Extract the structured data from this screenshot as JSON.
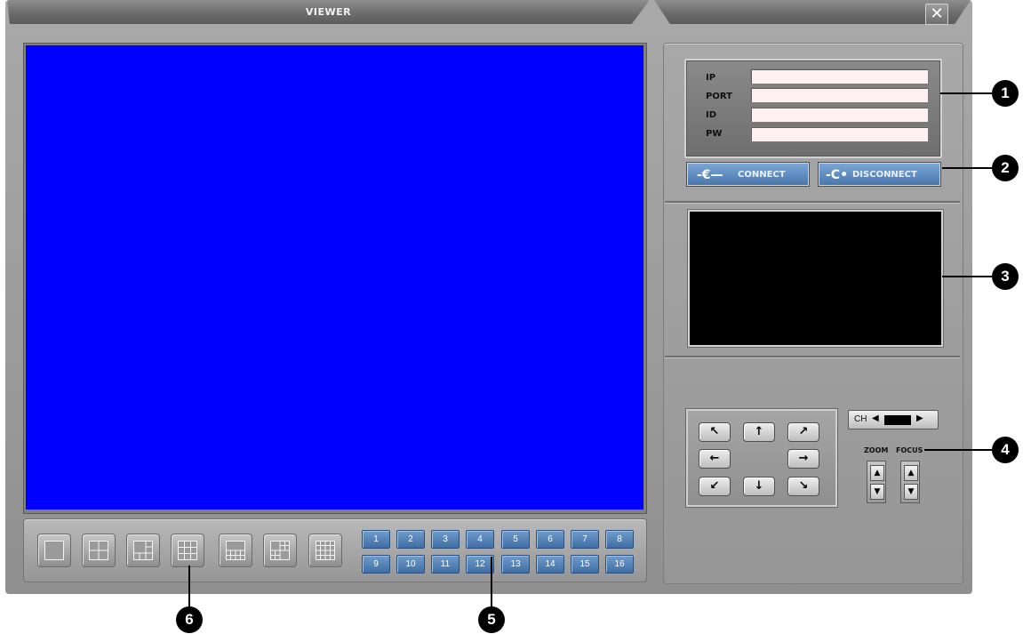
{
  "window": {
    "title": "VIEWER",
    "close_label": "✕"
  },
  "login": {
    "labels": [
      "IP",
      "PORT",
      "ID",
      "PW"
    ],
    "values": [
      "",
      "",
      "",
      ""
    ]
  },
  "connection": {
    "connect_label": "CONNECT",
    "disconnect_label": "DISCONNECT"
  },
  "channels": [
    "1",
    "2",
    "3",
    "4",
    "5",
    "6",
    "7",
    "8",
    "9",
    "10",
    "11",
    "12",
    "13",
    "14",
    "15",
    "16"
  ],
  "layouts": [
    "1-split",
    "4-split",
    "6-split",
    "9-split",
    "8-split",
    "10-split",
    "16-split"
  ],
  "ptz": {
    "ch_label": "CH",
    "zoom_label": "ZOOM",
    "focus_label": "FOCUS"
  },
  "callouts": [
    "1",
    "2",
    "3",
    "4",
    "5",
    "6"
  ],
  "colors": {
    "video_background": "#0000ff",
    "preview_background": "#000000",
    "channel_button": "#4a78ad"
  }
}
